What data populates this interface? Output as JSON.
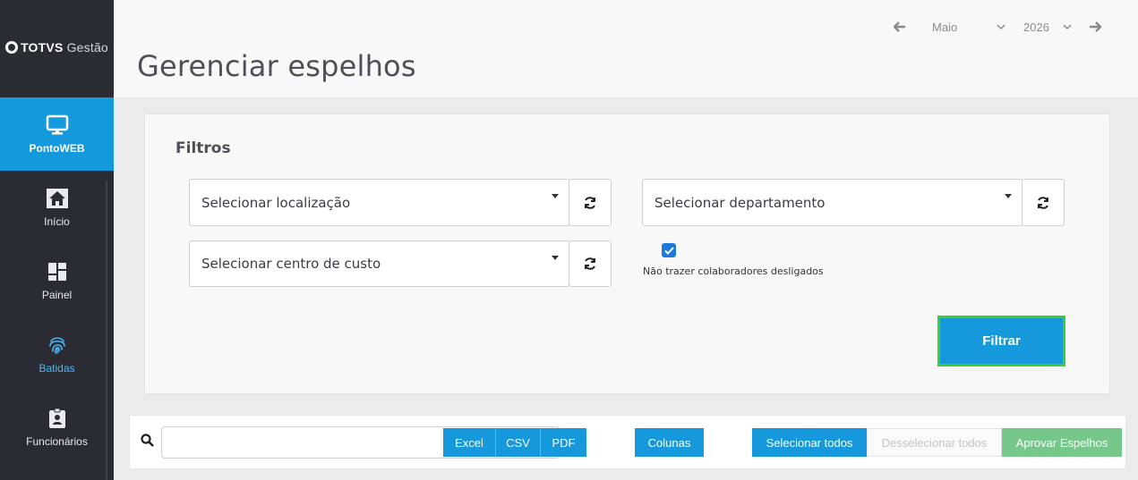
{
  "brand": {
    "name_bold": "TOTVS",
    "name_light": "Gestão"
  },
  "sidebar": {
    "items": [
      {
        "label": "PontoWEB",
        "icon": "monitor-icon",
        "active": true
      },
      {
        "label": "Início",
        "icon": "home-icon"
      },
      {
        "label": "Painel",
        "icon": "dashboard-icon"
      },
      {
        "label": "Batidas",
        "icon": "fingerprint-icon"
      },
      {
        "label": "Funcionários",
        "icon": "badge-icon"
      }
    ]
  },
  "header": {
    "title": "Gerenciar espelhos",
    "month": "Maio",
    "year": "2026"
  },
  "filters": {
    "title": "Filtros",
    "location_placeholder": "Selecionar localização",
    "department_placeholder": "Selecionar departamento",
    "cost_center_placeholder": "Selecionar centro de custo",
    "exclude_dismissed_label": "Não trazer colaboradores desligados",
    "exclude_dismissed_checked": true,
    "filter_button": "Filtrar"
  },
  "toolbar": {
    "search_value": "",
    "excel": "Excel",
    "csv": "CSV",
    "pdf": "PDF",
    "columns": "Colunas",
    "select_all": "Selecionar todos",
    "deselect_all": "Desselecionar todos",
    "approve": "Aprovar Espelhos"
  },
  "colors": {
    "accent": "#1599dc",
    "sidebar_bg": "#2b2b33",
    "highlight_border": "#36d03a",
    "approve": "#76c78a"
  }
}
